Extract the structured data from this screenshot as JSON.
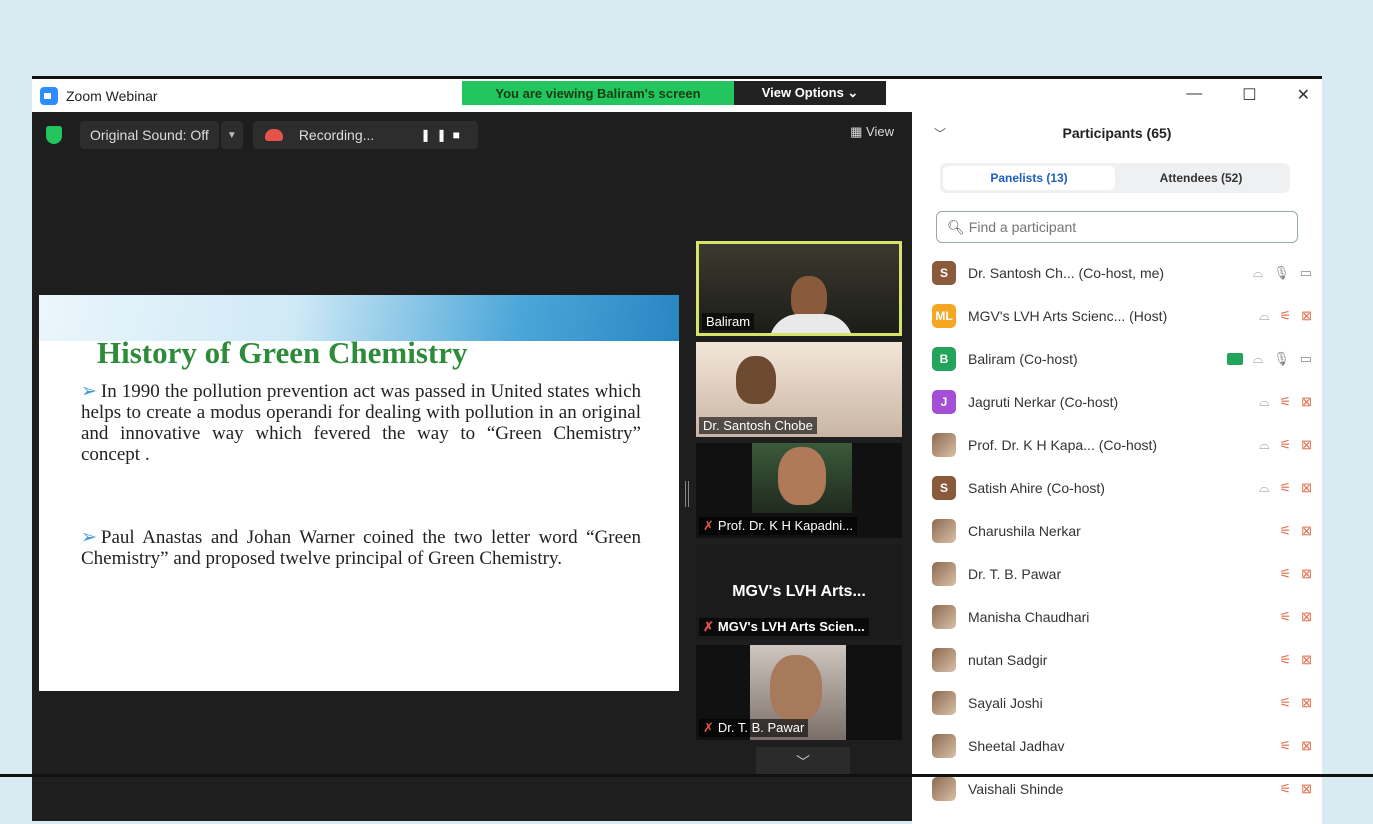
{
  "window": {
    "title": "Zoom Webinar"
  },
  "banner": {
    "viewing": "You are viewing Baliram's screen",
    "view_options": "View Options ⌄"
  },
  "toolbar": {
    "sound": "Original Sound: Off",
    "recording": "Recording...",
    "view": "View"
  },
  "slide": {
    "title": "History of Green Chemistry",
    "bullet1": "In 1990 the pollution prevention act was passed in United states which helps to create a modus operandi for dealing with pollution in an original and innovative way which fevered the way to “Green Chemistry” concept .",
    "bullet2": "Paul Anastas and Johan Warner coined the two letter word “Green Chemistry” and proposed twelve principal of Green Chemistry."
  },
  "videos": [
    {
      "name": "Baliram"
    },
    {
      "name": "Dr. Santosh Chobe"
    },
    {
      "name": "Prof. Dr. K H Kapadni..."
    },
    {
      "name": "MGV's LVH Arts Scien...",
      "display": "MGV's LVH Arts..."
    },
    {
      "name": "Dr. T. B. Pawar"
    }
  ],
  "panel": {
    "header": "Participants (65)",
    "tab_panelists": "Panelists (13)",
    "tab_attendees": "Attendees (52)",
    "search_placeholder": "Find a participant",
    "participants": [
      {
        "initials": "S",
        "name": "Dr. Santosh Ch... (Co-host, me)",
        "color": "#8a5a3c"
      },
      {
        "initials": "ML",
        "name": "MGV's LVH Arts Scienc... (Host)",
        "color": "#f5a623"
      },
      {
        "initials": "B",
        "name": "Baliram (Co-host)",
        "color": "#22a45a"
      },
      {
        "initials": "J",
        "name": "Jagruti Nerkar (Co-host)",
        "color": "#a34fd6"
      },
      {
        "initials": "",
        "name": "Prof. Dr. K H Kapa... (Co-host)",
        "color": ""
      },
      {
        "initials": "S",
        "name": "Satish Ahire (Co-host)",
        "color": "#8a5a3c"
      },
      {
        "initials": "",
        "name": "Charushila Nerkar",
        "color": ""
      },
      {
        "initials": "",
        "name": "Dr. T. B. Pawar",
        "color": ""
      },
      {
        "initials": "",
        "name": "Manisha Chaudhari",
        "color": ""
      },
      {
        "initials": "",
        "name": "nutan Sadgir",
        "color": ""
      },
      {
        "initials": "",
        "name": "Sayali Joshi",
        "color": ""
      },
      {
        "initials": "",
        "name": "Sheetal Jadhav",
        "color": ""
      },
      {
        "initials": "",
        "name": "Vaishali Shinde",
        "color": ""
      }
    ]
  }
}
